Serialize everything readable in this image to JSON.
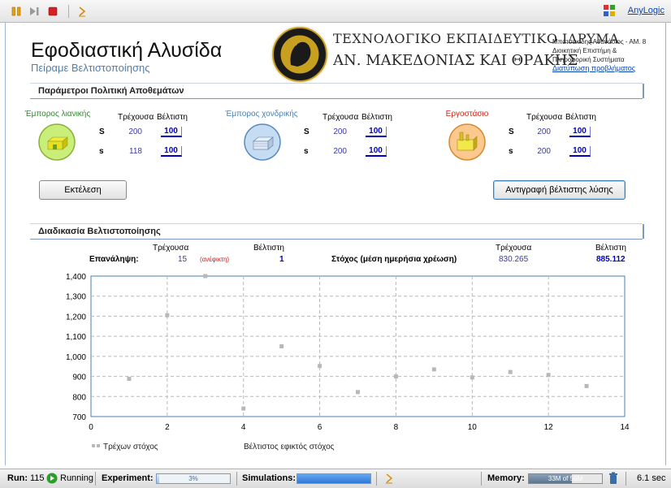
{
  "toolbar": {
    "anylogic_label": "AnyLogic"
  },
  "header": {
    "title": "Εφοδιαστική Αλυσίδα",
    "subtitle": "Πείραμε Βελτιστοποίησης",
    "institution_line1": "ΤΕΧΝΟΛΟΓΙΚΟ ΕΚΠΑΙΔΕΥΤΙΚΟ ΙΔΡΥΜΑ",
    "institution_line2": "ΑΝ. ΜΑΚΕΔΟΝΙΑΣ ΚΑΙ ΘΡΑΚΗΣ",
    "author_line1": "Μπατσακίδης Αθανάσιος - ΑΜ. 8",
    "author_line2": "Διοικητική Επιστήμη &",
    "author_line3": "Πληροφορική Συστήματα",
    "problem_link": "Διατύπωση προβλήματος"
  },
  "params": {
    "section_title": "Παράμετροι Πολιτική Αποθεμάτων",
    "col_current": "Τρέχουσα",
    "col_best": "Βέλτιστη",
    "agents": [
      {
        "label": "Έμπορος λιανικής",
        "label_color": "#2a8a2a",
        "icon": "retail-store-icon",
        "S_label": "S",
        "s_label": "s",
        "S_current": "200",
        "S_best": "100",
        "s_current": "118",
        "s_best": "100"
      },
      {
        "label": "Έμπορος χονδρικής",
        "label_color": "#4a7fb5",
        "icon": "wholesale-warehouse-icon",
        "S_label": "S",
        "s_label": "s",
        "S_current": "200",
        "S_best": "100",
        "s_current": "200",
        "s_best": "100"
      },
      {
        "label": "Εργοστάσιο",
        "label_color": "#cc2a1a",
        "icon": "factory-icon",
        "S_label": "S",
        "s_label": "s",
        "S_current": "200",
        "S_best": "100",
        "s_current": "200",
        "s_best": "100"
      }
    ]
  },
  "buttons": {
    "run": "Εκτέλεση",
    "copy_best": "Αντιγραφή βέλτιστης λύσης"
  },
  "optimization": {
    "section_title": "Διαδικασία Βελτιστοποίησης",
    "current_label": "Τρέχουσα",
    "best_label": "Βέλτιστη",
    "iteration_label": "Επανάληψη:",
    "iteration_current": "15",
    "iteration_infeasible": "(ανέφικτη)",
    "iteration_best": "1",
    "objective_label": "Στόχος (μέση ημερήσια χρέωση)",
    "objective_current": "830.265",
    "objective_best": "885.112"
  },
  "chart_data": {
    "type": "scatter",
    "xlim": [
      0,
      14
    ],
    "ylim": [
      700,
      1400
    ],
    "x_ticks": [
      "0",
      "2",
      "4",
      "6",
      "8",
      "10",
      "12",
      "14"
    ],
    "y_ticks": [
      "700",
      "800",
      "900",
      "1,000",
      "1,100",
      "1,200",
      "1,300",
      "1,400"
    ],
    "grid": true,
    "legend_position": "bottom-left",
    "series": [
      {
        "name": "Τρέχων στόχος",
        "color": "#b8b8b8",
        "points": [
          [
            1,
            888
          ],
          [
            2,
            1205
          ],
          [
            3,
            1400
          ],
          [
            4,
            740
          ],
          [
            5,
            1050
          ],
          [
            6,
            952
          ],
          [
            7,
            822
          ],
          [
            8,
            900
          ],
          [
            9,
            935
          ],
          [
            10,
            895
          ],
          [
            11,
            922
          ],
          [
            12,
            907
          ],
          [
            13,
            852
          ]
        ]
      },
      {
        "name": "Βέλτιστος εφικτός στόχος",
        "color": "#3a3a9a",
        "points": []
      }
    ]
  },
  "status": {
    "run_label": "Run:",
    "run_number": "115",
    "running_label": "Running",
    "experiment_label": "Experiment:",
    "experiment_progress": 0.03,
    "experiment_progress_text": "3%",
    "simulations_label": "Simulations:",
    "simulations_progress": 1.0,
    "memory_label": "Memory:",
    "memory_text": "33M of 56M",
    "memory_fraction": 0.59,
    "time_text": "6.1 sec"
  }
}
